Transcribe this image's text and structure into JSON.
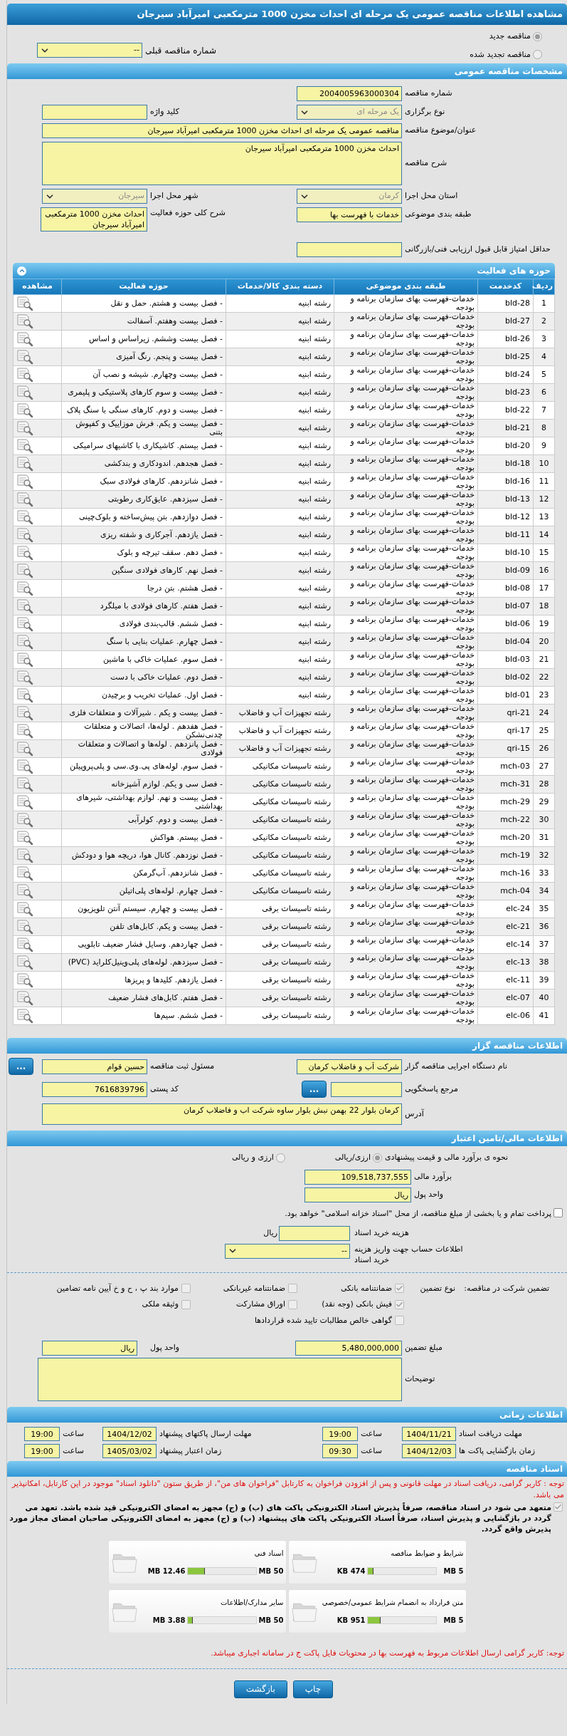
{
  "title": "مشاهده اطلاعات مناقصه عمومی یک مرحله ای احداث مخزن 1000 مترمکعبی امیرآباد سیرجان",
  "tender_type": [
    {
      "label": "مناقصه جدید",
      "selected": true
    },
    {
      "label": "مناقصه تجدید شده",
      "selected": false
    }
  ],
  "previous_tender": {
    "label": "شماره مناقصه قبلی",
    "kind": "select",
    "value": "--",
    "disabled": false
  },
  "general": {
    "heading": "مشخصات مناقصه عمومی",
    "tender_number": {
      "label": "شماره مناقصه",
      "kind": "text",
      "value": "2004005963000304"
    },
    "holding_type": {
      "label": "نوع برگزاری",
      "kind": "select",
      "value": "یک مرحله ای",
      "disabled": true
    },
    "keyword": {
      "label": "کلید واژه",
      "kind": "text"
    },
    "subject": {
      "label": "عنوان/موضوع مناقصه",
      "kind": "text",
      "value": "مناقصه عمومی یک مرحله ای احداث مخزن 1000 مترمکعبی امیرآباد سیرجان"
    },
    "description": {
      "label": "شرح مناقصه",
      "kind": "area",
      "value": "احداث مخزن 1000 مترمکعبی امیرآباد سیرجان"
    },
    "province": {
      "label": "استان محل اجرا",
      "kind": "select",
      "value": "کرمان",
      "disabled": true
    },
    "city": {
      "label": "شهر محل اجرا",
      "kind": "select",
      "value": "سیرجان",
      "disabled": true
    },
    "classification": {
      "label": "طبقه بندی موضوعی",
      "kind": "text",
      "value": "خدمات با فهرست بها"
    },
    "activity_summary": {
      "label": "شرح کلی حوزه فعالیت",
      "kind": "area",
      "value": "احداث مخزن 1000 مترمکعبی امیرآباد سیرجان"
    },
    "min_score": {
      "label": "حداقل امتیاز قابل قبول ارزیابی فنی/بازرگانی",
      "kind": "text"
    }
  },
  "activities": {
    "heading": "حوزه های فعالیت",
    "columns": [
      "ردیف",
      "کدخدمت",
      "طبقه بندی موضوعی",
      "دسته بندی کالا/خدمات",
      "حوزه فعالیت",
      "مشاهده"
    ],
    "rows": [
      {
        "no": "1",
        "code": "bld-28",
        "category": "خدمات-فهرست بهای سازمان برنامه و بودجه",
        "group": "رشته ابنیه",
        "activity": "- فصل بیست و هشتم. حمل و نقل"
      },
      {
        "no": "2",
        "code": "bld-27",
        "category": "خدمات-فهرست بهای سازمان برنامه و بودجه",
        "group": "رشته ابنیه",
        "activity": "- فصل بیست وهفتم. آسفالت"
      },
      {
        "no": "3",
        "code": "bld-26",
        "category": "خدمات-فهرست بهای سازمان برنامه و بودجه",
        "group": "رشته ابنیه",
        "activity": "- فصل بیست وششم. زیراساس و اساس"
      },
      {
        "no": "4",
        "code": "bld-25",
        "category": "خدمات-فهرست بهای سازمان برنامه و بودجه",
        "group": "رشته ابنیه",
        "activity": "- فصل بیست و پنجم. رنگ آمیزی"
      },
      {
        "no": "5",
        "code": "bld-24",
        "category": "خدمات-فهرست بهای سازمان برنامه و بودجه",
        "group": "رشته ابنیه",
        "activity": "- فصل بیست وچهارم. شیشه و نصب آن"
      },
      {
        "no": "6",
        "code": "bld-23",
        "category": "خدمات-فهرست بهای سازمان برنامه و بودجه",
        "group": "رشته ابنیه",
        "activity": "- فصل بیست و سوم کارهای پلاستیکی و پلیمری"
      },
      {
        "no": "7",
        "code": "bld-22",
        "category": "خدمات-فهرست بهای سازمان برنامه و بودجه",
        "group": "رشته ابنیه",
        "activity": "- فصل بیست و دوم. کارهای سنگی با سنگ پلاک"
      },
      {
        "no": "8",
        "code": "bld-21",
        "category": "خدمات-فهرست بهای سازمان برنامه و بودجه",
        "group": "رشته ابنیه",
        "activity": "- فصل بیست و یکم. فرش موزاییک و کفپوش بتنی"
      },
      {
        "no": "9",
        "code": "bld-20",
        "category": "خدمات-فهرست بهای سازمان برنامه و بودجه",
        "group": "رشته ابنیه",
        "activity": "- فصل بیستم. کاشیکاری با کاشیهای سرامیکی"
      },
      {
        "no": "10",
        "code": "bld-18",
        "category": "خدمات-فهرست بهای سازمان برنامه و بودجه",
        "group": "رشته ابنیه",
        "activity": "- فصل هجدهم. اندودکاری و بندکشی"
      },
      {
        "no": "11",
        "code": "bld-16",
        "category": "خدمات-فهرست بهای سازمان برنامه و بودجه",
        "group": "رشته ابنیه",
        "activity": "- فصل شانزدهم. کارهای فولادی سبک"
      },
      {
        "no": "12",
        "code": "bld-13",
        "category": "خدمات-فهرست بهای سازمان برنامه و بودجه",
        "group": "رشته ابنیه",
        "activity": "- فصل سیزدهم. عایق‌کاری رطوبتی"
      },
      {
        "no": "13",
        "code": "bld-12",
        "category": "خدمات-فهرست بهای سازمان برنامه و بودجه",
        "group": "رشته ابنیه",
        "activity": "- فصل دوازدهم. بتن پیش‌ساخته و بلوک‌چینی"
      },
      {
        "no": "14",
        "code": "bld-11",
        "category": "خدمات-فهرست بهای سازمان برنامه و بودجه",
        "group": "رشته ابنیه",
        "activity": "- فصل یازدهم. آجرکاری و شفته ریزی"
      },
      {
        "no": "15",
        "code": "bld-10",
        "category": "خدمات-فهرست بهای سازمان برنامه و بودجه",
        "group": "رشته ابنیه",
        "activity": "- فصل دهم. سقف تیرچه و بلوک"
      },
      {
        "no": "16",
        "code": "bld-09",
        "category": "خدمات-فهرست بهای سازمان برنامه و بودجه",
        "group": "رشته ابنیه",
        "activity": "- فصل نهم. کارهای فولادی سنگین"
      },
      {
        "no": "17",
        "code": "bld-08",
        "category": "خدمات-فهرست بهای سازمان برنامه و بودجه",
        "group": "رشته ابنیه",
        "activity": "- فصل هشتم. بتن درجا"
      },
      {
        "no": "18",
        "code": "bld-07",
        "category": "خدمات-فهرست بهای سازمان برنامه و بودجه",
        "group": "رشته ابنیه",
        "activity": "- فصل هفتم. کارهای فولادی با میلگرد"
      },
      {
        "no": "19",
        "code": "bld-06",
        "category": "خدمات-فهرست بهای سازمان برنامه و بودجه",
        "group": "رشته ابنیه",
        "activity": "- فصل ششم. قالب‌بندی فولادی"
      },
      {
        "no": "20",
        "code": "bld-04",
        "category": "خدمات-فهرست بهای سازمان برنامه و بودجه",
        "group": "رشته ابنیه",
        "activity": "- فصل چهارم. عملیات بنایی با سنگ"
      },
      {
        "no": "21",
        "code": "bld-03",
        "category": "خدمات-فهرست بهای سازمان برنامه و بودجه",
        "group": "رشته ابنیه",
        "activity": "- فصل سوم. عملیات خاکی با ماشین"
      },
      {
        "no": "22",
        "code": "bld-02",
        "category": "خدمات-فهرست بهای سازمان برنامه و بودجه",
        "group": "رشته ابنیه",
        "activity": "- فصل دوم. عملیات خاکی با دست"
      },
      {
        "no": "23",
        "code": "bld-01",
        "category": "خدمات-فهرست بهای سازمان برنامه و بودجه",
        "group": "رشته ابنیه",
        "activity": "- فصل اول. عملیات تخریب و برچیدن"
      },
      {
        "no": "24",
        "code": "qri-21",
        "category": "خدمات-فهرست بهای سازمان برنامه و بودجه",
        "group": "رشته تجهیزات آب و فاضلاب",
        "activity": "- فصل بیست و یکم . شیرآلات و متعلقات فلزی"
      },
      {
        "no": "25",
        "code": "qri-17",
        "category": "خدمات-فهرست بهای سازمان برنامه و بودجه",
        "group": "رشته تجهیزات آب و فاضلاب",
        "activity": "- فصل هفدهم . لوله‌ها، اتصالات و متعلقات چدنی‌نشکن"
      },
      {
        "no": "26",
        "code": "qri-15",
        "category": "خدمات-فهرست بهای سازمان برنامه و بودجه",
        "group": "رشته تجهیزات آب و فاضلاب",
        "activity": "- فصل پانزدهم . لوله‌ها و اتصالات و متعلقات فولادی"
      },
      {
        "no": "27",
        "code": "mch-03",
        "category": "خدمات-فهرست بهای سازمان برنامه و بودجه",
        "group": "رشته تاسیسات مکانیکی",
        "activity": "- فصل سوم. لوله‌های پی.وی.سی و پلی‌پروپیلن"
      },
      {
        "no": "28",
        "code": "mch-31",
        "category": "خدمات-فهرست بهای سازمان برنامه و بودجه",
        "group": "رشته تاسیسات مکانیکی",
        "activity": "- فصل سی و یکم. لوازم آشپزخانه"
      },
      {
        "no": "29",
        "code": "mch-29",
        "category": "خدمات-فهرست بهای سازمان برنامه و بودجه",
        "group": "رشته تاسیسات مکانیکی",
        "activity": "- فصل بیست و نهم. لوازم بهداشتی، شیرهای بهداشتی"
      },
      {
        "no": "30",
        "code": "mch-22",
        "category": "خدمات-فهرست بهای سازمان برنامه و بودجه",
        "group": "رشته تاسیسات مکانیکی",
        "activity": "- فصل بیست و دوم. کولرآبی"
      },
      {
        "no": "31",
        "code": "mch-20",
        "category": "خدمات-فهرست بهای سازمان برنامه و بودجه",
        "group": "رشته تاسیسات مکانیکی",
        "activity": "- فصل بیستم. هواکش"
      },
      {
        "no": "32",
        "code": "mch-19",
        "category": "خدمات-فهرست بهای سازمان برنامه و بودجه",
        "group": "رشته تاسیسات مکانیکی",
        "activity": "- فصل نوزدهم. کانال هوا، دریچه هوا و دودکش"
      },
      {
        "no": "33",
        "code": "mch-16",
        "category": "خدمات-فهرست بهای سازمان برنامه و بودجه",
        "group": "رشته تاسیسات مکانیکی",
        "activity": "- فصل شانزدهم. آب‌گرمکن"
      },
      {
        "no": "34",
        "code": "mch-04",
        "category": "خدمات-فهرست بهای سازمان برنامه و بودجه",
        "group": "رشته تاسیسات مکانیکی",
        "activity": "- فصل چهارم. لوله‌های پلی‌اتیلن"
      },
      {
        "no": "35",
        "code": "elc-24",
        "category": "خدمات-فهرست بهای سازمان برنامه و بودجه",
        "group": "رشته تاسیسات برقی",
        "activity": "- فصل بیست و چهارم. سیستم آنتن تلویزیون"
      },
      {
        "no": "36",
        "code": "elc-21",
        "category": "خدمات-فهرست بهای سازمان برنامه و بودجه",
        "group": "رشته تاسیسات برقی",
        "activity": "- فصل بیست و یکم. کابل‌های تلفن"
      },
      {
        "no": "37",
        "code": "elc-14",
        "category": "خدمات-فهرست بهای سازمان برنامه و بودجه",
        "group": "رشته تاسیسات برقی",
        "activity": "- فصل چهاردهم. وسایل فشار ضعیف تابلویی"
      },
      {
        "no": "38",
        "code": "elc-13",
        "category": "خدمات-فهرست بهای سازمان برنامه و بودجه",
        "group": "رشته تاسیسات برقی",
        "activity": "- فصل سیزدهم. لوله‌های پلی‌وینیل‌کلراید (PVC)"
      },
      {
        "no": "39",
        "code": "elc-11",
        "category": "خدمات-فهرست بهای سازمان برنامه و بودجه",
        "group": "رشته تاسیسات برقی",
        "activity": "- فصل یازدهم. کلیدها و پریزها"
      },
      {
        "no": "40",
        "code": "elc-07",
        "category": "خدمات-فهرست بهای سازمان برنامه و بودجه",
        "group": "رشته تاسیسات برقی",
        "activity": "- فصل هفتم. کابل‌های فشار ضعیف"
      },
      {
        "no": "41",
        "code": "elc-06",
        "category": "خدمات-فهرست بهای سازمان برنامه و بودجه",
        "group": "رشته تاسیسات برقی",
        "activity": "- فصل ششم. سیم‌ها"
      }
    ]
  },
  "tenderer": {
    "heading": "اطلاعات مناقصه گزار",
    "organization": {
      "label": "نام دستگاه اجرایی مناقصه گزار",
      "kind": "text",
      "value": "شرکت آب و فاضلاب کرمان"
    },
    "responsible": {
      "label": "مسئول ثبت مناقصه",
      "kind": "text",
      "value": "حسین قوام"
    },
    "responsible_button": "...",
    "reference": {
      "label": "مرجع پاسخگویی",
      "kind": "text"
    },
    "reference_button": "...",
    "postal_code": {
      "label": "کد پستی",
      "kind": "text",
      "value": "7616839796"
    },
    "address": {
      "label": "آدرس",
      "kind": "area",
      "value": "کرمان بلوار 22 بهمن نبش بلوار ساوه شرکت اب و فاضلاب کرمان"
    }
  },
  "finance": {
    "heading": "اطلاعات مالی/تامین اعتبار",
    "method_label": "نحوه ی برآورد مالی و قیمت پیشنهادی",
    "methods": [
      {
        "label": "ارزی/ریالی",
        "selected": true
      },
      {
        "label": "ارزی و ریالی",
        "selected": false
      }
    ],
    "estimate": {
      "label": "برآورد مالی",
      "kind": "text",
      "value": "109,518,737,555"
    },
    "currency": {
      "label": "واحد پول",
      "kind": "text",
      "value": "ریال"
    },
    "treasury": {
      "label": "پرداخت تمام و یا بخشی از مبلغ مناقصه، از محل \"اسناد خزانه اسلامی\" خواهد بود.",
      "checked": false
    },
    "document_fee": {
      "label": "هزینه خرید اسناد",
      "kind": "text",
      "unit": "ریال"
    },
    "account": {
      "label": "اطلاعات حساب جهت واریز هزینه خرید اسناد",
      "kind": "select",
      "value": "--",
      "disabled": false
    }
  },
  "guarantee": {
    "label": "تضمین شرکت در مناقصه:",
    "type_label": "نوع تضمین",
    "options": [
      {
        "label": "ضمانتنامه بانکی",
        "checked": true
      },
      {
        "label": "ضمانتنامه غیربانکی",
        "checked": false
      },
      {
        "label": "موارد بند پ ، ح و خ آیین نامه تضامین",
        "checked": false
      },
      {
        "label": "فیش بانکی (وجه نقد)",
        "checked": true
      },
      {
        "label": "اوراق مشارکت",
        "checked": false
      },
      {
        "label": "وثیقه ملکی",
        "checked": false
      },
      {
        "label": "گواهی خالص مطالبات تایید شده قراردادها",
        "checked": false
      }
    ],
    "amount": {
      "label": "مبلغ تضمین",
      "kind": "text",
      "value": "5,480,000,000"
    },
    "currency": {
      "label": "واحد پول",
      "kind": "text",
      "value": "ریال"
    },
    "notes": {
      "label": "توضیحات",
      "kind": "area"
    }
  },
  "schedule": {
    "heading": "اطلاعات زمانی",
    "items": [
      {
        "label": "مهلت دریافت اسناد",
        "date": "1404/11/21",
        "time_label": "ساعت",
        "time": "19:00"
      },
      {
        "label": "مهلت ارسال پاکتهای پیشنهاد",
        "date": "1404/12/02",
        "time_label": "ساعت",
        "time": "19:00"
      },
      {
        "label": "زمان بازگشایی پاکت ها",
        "date": "1404/12/03",
        "time_label": "ساعت",
        "time": "09:30"
      },
      {
        "label": "زمان اعتبار پیشنهاد",
        "date": "1405/03/02",
        "time_label": "ساعت",
        "time": "19:00"
      }
    ]
  },
  "documents": {
    "heading": "اسناد مناقصه",
    "notice": "توجه : کاربر گرامی، دریافت اسناد در مهلت قانونی و پس از افزودن فراخوان به کارتابل \"فراخوان های من\"، از طریق ستون \"دانلود اسناد\" موجود در این کارتابل، امکانپذیر می باشد.",
    "commitment": {
      "label": "متعهد می شود در اسناد مناقصه، صرفاً پذیرش اسناد الکترونیکی پاکت های (ب) و (ج) مجهز به امضای الکترونیکی قید شده باشد. تعهد می گردد در بازگشایی و پذیرش اسناد، صرفاً اسناد الکترونیکی پاکت های پیشنهاد (ب) و (ج) مجهز به امضای الکترونیکی صاحبان امضای مجاز مورد پذیرش واقع گردد.",
      "checked": true
    },
    "files": [
      {
        "name": "شرایط و ضوابط مناقصه",
        "max": "5 MB",
        "used": "474 KB",
        "level": 0.09
      },
      {
        "name": "اسناد فنی",
        "max": "50 MB",
        "used": "12.46 MB",
        "level": 0.25
      },
      {
        "name": "متن قرارداد به انضمام شرایط عمومی/خصوصی",
        "max": "5 MB",
        "used": "951 KB",
        "level": 0.19
      },
      {
        "name": "سایر مدارک/اطلاعات",
        "max": "50 MB",
        "used": "3.88 MB",
        "level": 0.08
      }
    ],
    "footer_notice": "توجه: کاربر گرامی ارسال اطلاعات مربوط به فهرست بها در محتویات فایل پاکت ج در سامانه اجباری میباشد."
  },
  "buttons": [
    {
      "label": "چاپ"
    },
    {
      "label": "بازگشت"
    }
  ]
}
